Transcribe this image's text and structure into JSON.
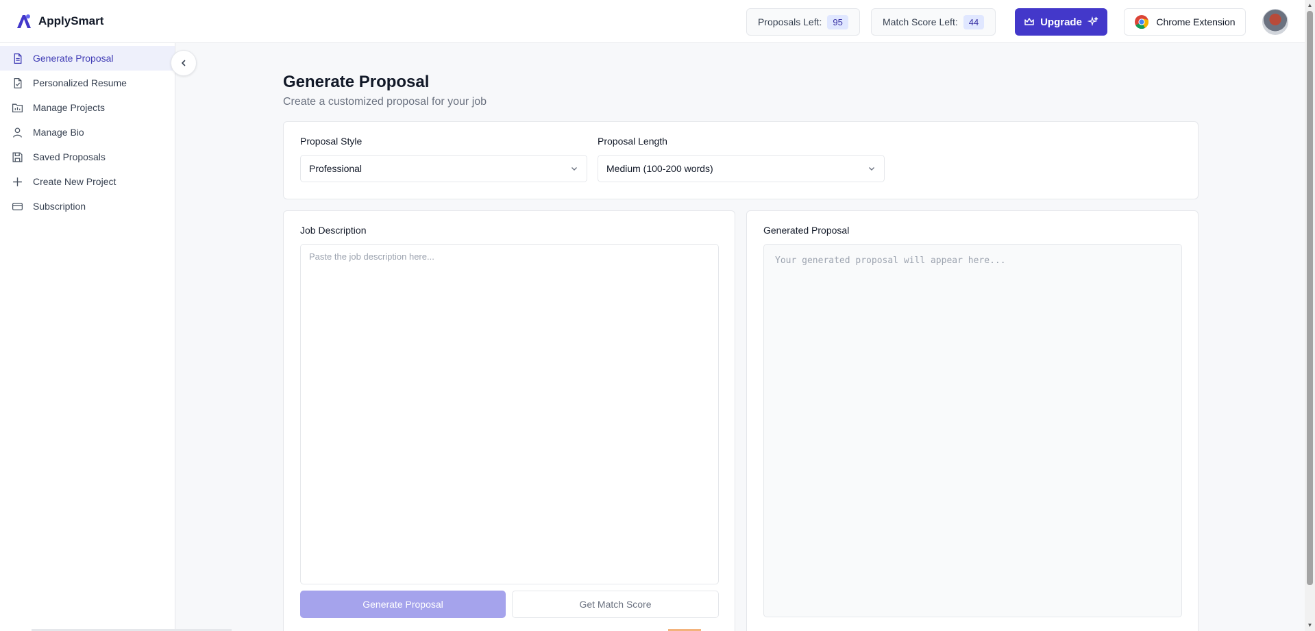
{
  "app": {
    "name": "ApplySmart"
  },
  "header": {
    "proposals_left_label": "Proposals Left:",
    "proposals_left_value": "95",
    "match_score_left_label": "Match Score Left:",
    "match_score_left_value": "44",
    "upgrade_label": "Upgrade",
    "chrome_extension_label": "Chrome Extension"
  },
  "sidebar": {
    "items": [
      {
        "label": "Generate Proposal",
        "icon": "file-text-icon",
        "active": true
      },
      {
        "label": "Personalized Resume",
        "icon": "file-check-icon"
      },
      {
        "label": "Manage Projects",
        "icon": "folder-chart-icon"
      },
      {
        "label": "Manage Bio",
        "icon": "user-icon"
      },
      {
        "label": "Saved Proposals",
        "icon": "save-icon"
      },
      {
        "label": "Create New Project",
        "icon": "plus-icon"
      },
      {
        "label": "Subscription",
        "icon": "credit-card-icon"
      }
    ]
  },
  "main": {
    "title": "Generate Proposal",
    "subtitle": "Create a customized proposal for your job",
    "style_label": "Proposal Style",
    "style_value": "Professional",
    "length_label": "Proposal Length",
    "length_value": "Medium (100-200 words)",
    "job_description_label": "Job Description",
    "job_description_placeholder": "Paste the job description here...",
    "generated_label": "Generated Proposal",
    "generated_placeholder": "Your generated proposal will appear here...",
    "generate_button": "Generate Proposal",
    "match_button": "Get Match Score"
  },
  "colors": {
    "accent": "#4338ca",
    "active_bg": "#eef0fb",
    "disabled_primary": "#a5a3ec"
  }
}
